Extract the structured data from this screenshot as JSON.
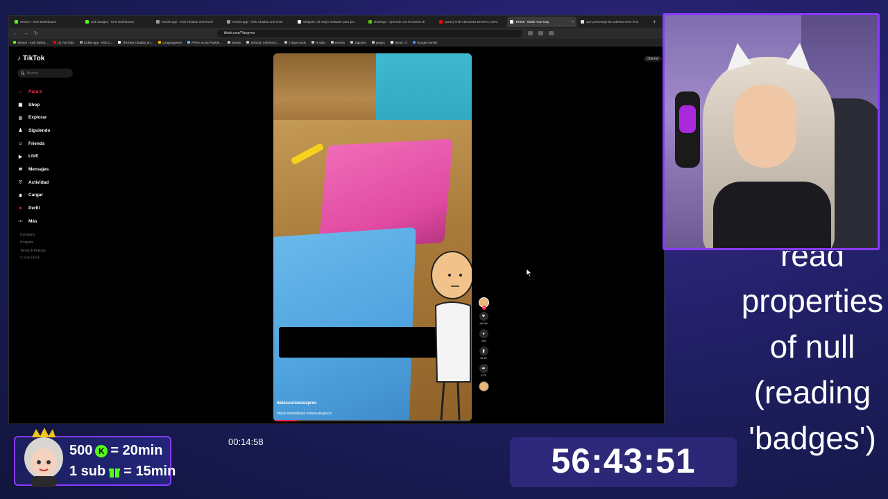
{
  "browser": {
    "tabs": [
      {
        "label": "Stream - Kick Dashboard",
        "color": "#53fc18",
        "active": false
      },
      {
        "label": "Sub Badges - Kick Dashboard",
        "color": "#53fc18",
        "active": false
      },
      {
        "label": "Kicklet.app - Kick Chatbot and Overl",
        "color": "#999999",
        "active": false
      },
      {
        "label": "Kicklet.app - Kick Chatbot and Over",
        "color": "#999999",
        "active": false
      },
      {
        "label": "Widgets | El mejor software para por",
        "color": "#ffffff",
        "active": false
      },
      {
        "label": "Duolingo - Aprende con lecciones di",
        "color": "#58cc02",
        "active": false
      },
      {
        "label": "(1531) THE AMAZING DIGITAL CIRC",
        "color": "#ff0000",
        "active": false
      },
      {
        "label": "TikTok - Make Your Day",
        "color": "#ffffff",
        "active": true
      },
      {
        "label": "que porcentaje de asbesto tiene el la",
        "color": "#dddddd",
        "active": false
      }
    ],
    "new_tab": "+",
    "url": "tiktok.com/?lang=es",
    "bookmarks": [
      {
        "label": "Stream - Kick Dashb...",
        "color": "#53fc18"
      },
      {
        "label": "(1) YouTube",
        "color": "#ff0000"
      },
      {
        "label": "Kicklet.app - Kick C...",
        "color": "#999999"
      },
      {
        "label": "The best ChatBot an...",
        "color": "#ffffff"
      },
      {
        "label": "Leaguegames",
        "color": "#ffaa00"
      },
      {
        "label": "PRAK Scout Plushie...",
        "color": "#66aaff"
      },
      {
        "label": "stream",
        "color": "#bbbbbb"
      },
      {
        "label": "Servidor | Aternos |...",
        "color": "#bbbbbb"
      },
      {
        "label": "7 days mods",
        "color": "#bbbbbb"
      },
      {
        "label": "R subs",
        "color": "#bbbbbb"
      },
      {
        "label": "emotes",
        "color": "#bbbbbb"
      },
      {
        "label": "Japones",
        "color": "#bbbbbb"
      },
      {
        "label": "juegos",
        "color": "#bbbbbb"
      },
      {
        "label": "Home / X",
        "color": "#ffffff"
      },
      {
        "label": "Google Gemini",
        "color": "#4e8cff"
      }
    ]
  },
  "tiktok": {
    "logo": "TikTok",
    "search_placeholder": "Buscar",
    "obtain_label": "Obtener",
    "nav": [
      {
        "label": "Para ti",
        "icon": "home-icon",
        "active": true
      },
      {
        "label": "Shop",
        "icon": "shop-icon",
        "active": false
      },
      {
        "label": "Explorar",
        "icon": "compass-icon",
        "active": false
      },
      {
        "label": "Siguiendo",
        "icon": "following-icon",
        "active": false
      },
      {
        "label": "Friends",
        "icon": "friends-icon",
        "active": false
      },
      {
        "label": "LIVE",
        "icon": "live-icon",
        "active": false
      },
      {
        "label": "Mensajes",
        "icon": "messages-icon",
        "active": false
      },
      {
        "label": "Actividad",
        "icon": "activity-icon",
        "active": false
      },
      {
        "label": "Cargar",
        "icon": "upload-icon",
        "active": false
      },
      {
        "label": "Perfil",
        "icon": "profile-icon",
        "active": false
      },
      {
        "label": "Más",
        "icon": "more-icon",
        "active": false
      }
    ],
    "footer": [
      "Company",
      "Program",
      "Terms & Policies"
    ],
    "copyright": "© 2026 TikTok",
    "video": {
      "creator": "datoscuriososspros",
      "hashtags": "#facts #mindblown #interestingfacts",
      "progress": 0.12
    },
    "actions": {
      "likes": "190.5K",
      "comments": "425",
      "saves": "16.2K",
      "shares": "4773"
    }
  },
  "overlay": {
    "error_lines": [
      "read",
      "properties",
      "of null",
      "(reading",
      "'badges')"
    ],
    "sub_rate_1": "500",
    "sub_rate_1_rest": "= 20min",
    "sub_rate_2": "1 sub",
    "sub_rate_2_rest": "= 15min",
    "elapsed": "00:14:58",
    "timer": "56:43:51"
  },
  "colors": {
    "kick_green": "#53fc18",
    "tiktok_red": "#fe2c55",
    "frame_purple": "#8a3bff"
  }
}
